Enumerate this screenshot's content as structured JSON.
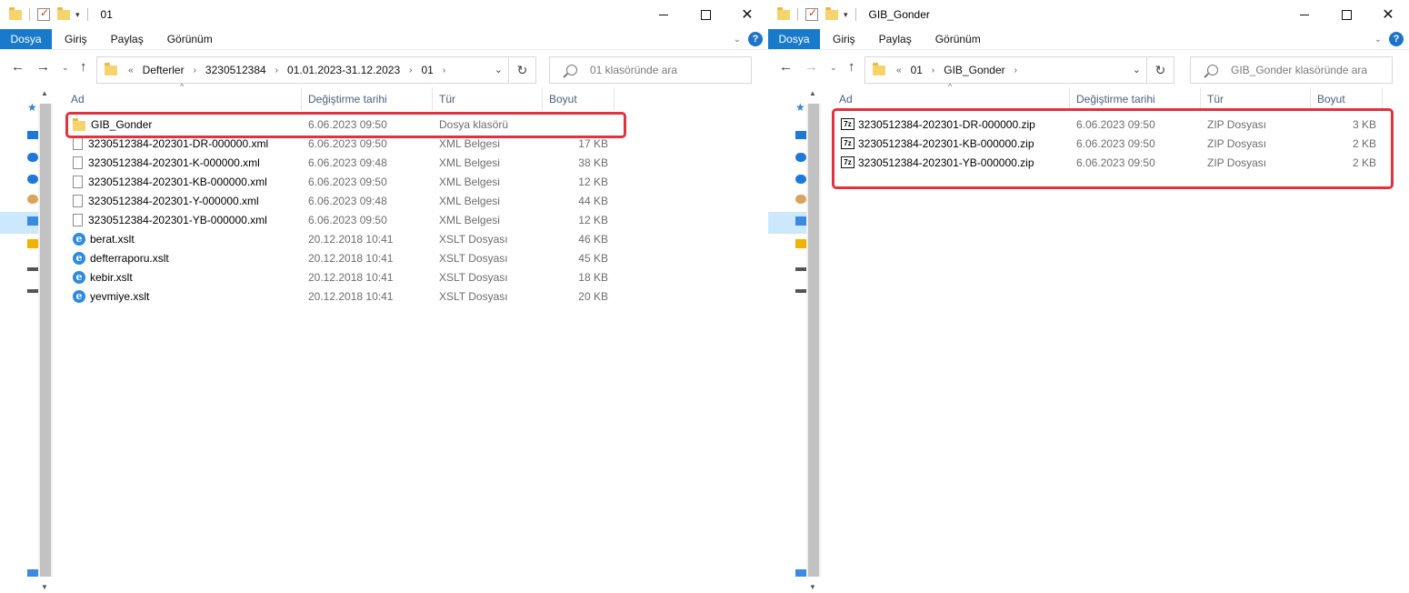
{
  "windows": [
    {
      "title": "01",
      "ribbon_tabs": [
        "Dosya",
        "Giriş",
        "Paylaş",
        "Görünüm"
      ],
      "breadcrumb": [
        "Defterler",
        "3230512384",
        "01.01.2023-31.12.2023",
        "01"
      ],
      "search_placeholder": "01 klasöründe ara",
      "columns": [
        "Ad",
        "Değiştirme tarihi",
        "Tür",
        "Boyut"
      ],
      "files": [
        {
          "icon": "folder-icon",
          "name": "GIB_Gonder",
          "date": "6.06.2023 09:50",
          "type": "Dosya klasörü",
          "size": ""
        },
        {
          "icon": "xml-file-icon",
          "name": "3230512384-202301-DR-000000.xml",
          "date": "6.06.2023 09:50",
          "type": "XML Belgesi",
          "size": "17 KB"
        },
        {
          "icon": "xml-file-icon",
          "name": "3230512384-202301-K-000000.xml",
          "date": "6.06.2023 09:48",
          "type": "XML Belgesi",
          "size": "38 KB"
        },
        {
          "icon": "xml-file-icon",
          "name": "3230512384-202301-KB-000000.xml",
          "date": "6.06.2023 09:50",
          "type": "XML Belgesi",
          "size": "12 KB"
        },
        {
          "icon": "xml-file-icon",
          "name": "3230512384-202301-Y-000000.xml",
          "date": "6.06.2023 09:48",
          "type": "XML Belgesi",
          "size": "44 KB"
        },
        {
          "icon": "xml-file-icon",
          "name": "3230512384-202301-YB-000000.xml",
          "date": "6.06.2023 09:50",
          "type": "XML Belgesi",
          "size": "12 KB"
        },
        {
          "icon": "internet-explorer-icon",
          "name": "berat.xslt",
          "date": "20.12.2018 10:41",
          "type": "XSLT Dosyası",
          "size": "46 KB"
        },
        {
          "icon": "internet-explorer-icon",
          "name": "defterraporu.xslt",
          "date": "20.12.2018 10:41",
          "type": "XSLT Dosyası",
          "size": "45 KB"
        },
        {
          "icon": "internet-explorer-icon",
          "name": "kebir.xslt",
          "date": "20.12.2018 10:41",
          "type": "XSLT Dosyası",
          "size": "18 KB"
        },
        {
          "icon": "internet-explorer-icon",
          "name": "yevmiye.xslt",
          "date": "20.12.2018 10:41",
          "type": "XSLT Dosyası",
          "size": "20 KB"
        }
      ]
    },
    {
      "title": "GIB_Gonder",
      "ribbon_tabs": [
        "Dosya",
        "Giriş",
        "Paylaş",
        "Görünüm"
      ],
      "breadcrumb": [
        "01",
        "GIB_Gonder"
      ],
      "search_placeholder": "GIB_Gonder klasöründe ara",
      "columns": [
        "Ad",
        "Değiştirme tarihi",
        "Tür",
        "Boyut"
      ],
      "files": [
        {
          "icon": "7zip-icon",
          "name": "3230512384-202301-DR-000000.zip",
          "date": "6.06.2023 09:50",
          "type": "ZIP Dosyası",
          "size": "3 KB"
        },
        {
          "icon": "7zip-icon",
          "name": "3230512384-202301-KB-000000.zip",
          "date": "6.06.2023 09:50",
          "type": "ZIP Dosyası",
          "size": "2 KB"
        },
        {
          "icon": "7zip-icon",
          "name": "3230512384-202301-YB-000000.zip",
          "date": "6.06.2023 09:50",
          "type": "ZIP Dosyası",
          "size": "2 KB"
        }
      ]
    }
  ],
  "glyphs": {
    "back": "←",
    "forward": "→",
    "recent": "⌄",
    "up": "↑",
    "crumb_sep": "›",
    "overflow": "«",
    "refresh": "↻",
    "dropdown": "⌄",
    "close": "✕",
    "help": "?",
    "sort": "^",
    "zip": "7z",
    "ie": "e"
  },
  "colors": {
    "file_tab": "#1979ca",
    "highlight": "#e2323f",
    "selection": "#cce8ff",
    "header_text": "#4c607a"
  }
}
